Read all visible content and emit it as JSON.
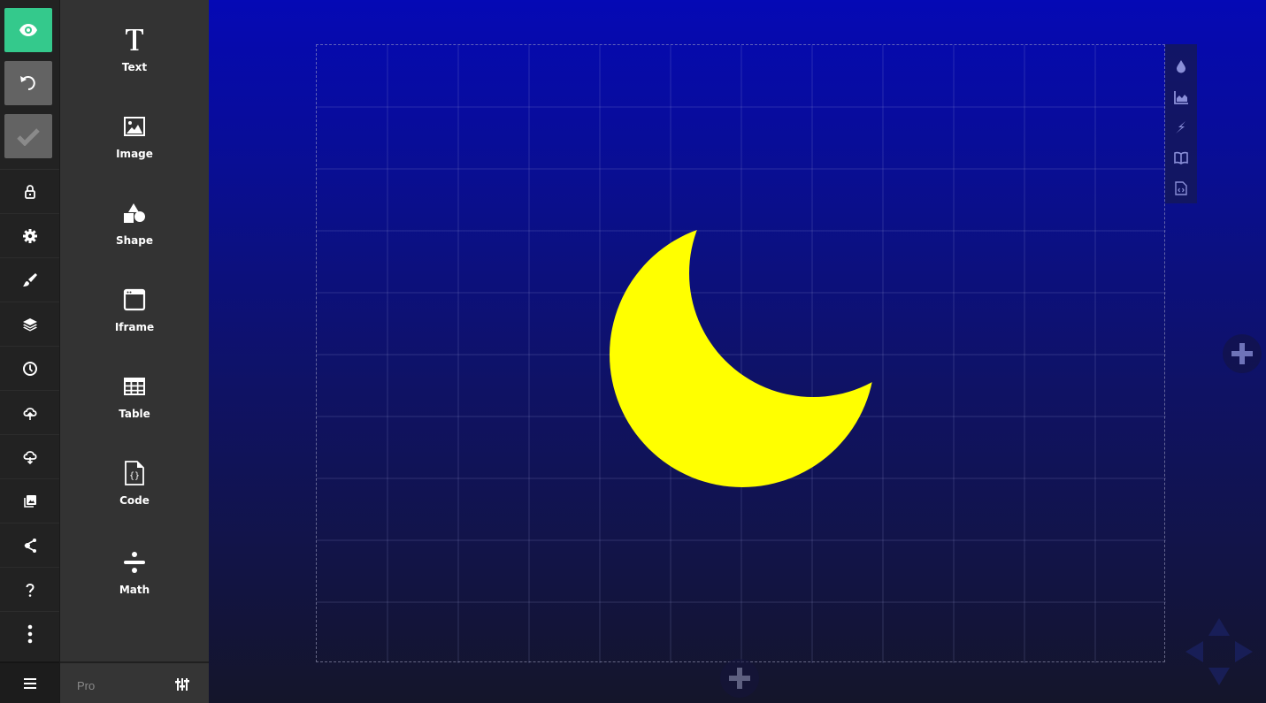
{
  "rail": {
    "top_buttons": [
      {
        "name": "preview",
        "icon": "eye-icon",
        "color": "#34c98c"
      },
      {
        "name": "undo",
        "icon": "undo-icon",
        "color": "#636363"
      },
      {
        "name": "save",
        "icon": "check-icon",
        "color": "#636363"
      }
    ],
    "items": [
      {
        "name": "lock",
        "icon": "lock-icon"
      },
      {
        "name": "settings",
        "icon": "gear-icon"
      },
      {
        "name": "style",
        "icon": "brush-icon"
      },
      {
        "name": "layers",
        "icon": "layers-icon"
      },
      {
        "name": "history",
        "icon": "clock-icon"
      },
      {
        "name": "upload",
        "icon": "cloud-upload-icon"
      },
      {
        "name": "download",
        "icon": "cloud-download-icon"
      },
      {
        "name": "media",
        "icon": "images-icon"
      },
      {
        "name": "share",
        "icon": "share-icon"
      },
      {
        "name": "help",
        "icon": "help-icon"
      },
      {
        "name": "more",
        "icon": "more-vertical-icon"
      }
    ],
    "menu_icon": "hamburger-icon"
  },
  "panel": {
    "widgets": [
      {
        "label": "Text",
        "icon": "text-icon"
      },
      {
        "label": "Image",
        "icon": "image-icon"
      },
      {
        "label": "Shape",
        "icon": "shape-icon"
      },
      {
        "label": "Iframe",
        "icon": "iframe-icon"
      },
      {
        "label": "Table",
        "icon": "table-icon"
      },
      {
        "label": "Code",
        "icon": "code-icon"
      },
      {
        "label": "Math",
        "icon": "math-icon"
      }
    ],
    "footer": {
      "pro_label": "Pro",
      "settings_icon": "sliders-icon"
    }
  },
  "stage": {
    "background_top": "#0509b5",
    "background_bottom": "#14152a",
    "shape": {
      "type": "crescent-moon",
      "fill": "#ffff00"
    },
    "side_tools": [
      {
        "name": "fill",
        "icon": "droplet-icon"
      },
      {
        "name": "chart",
        "icon": "area-chart-icon"
      },
      {
        "name": "animate",
        "icon": "bolt-icon"
      },
      {
        "name": "book",
        "icon": "book-icon"
      },
      {
        "name": "embed-code",
        "icon": "file-code-icon"
      }
    ],
    "add_icon": "plus-icon",
    "nav_icon": "arrows-pad-icon"
  }
}
